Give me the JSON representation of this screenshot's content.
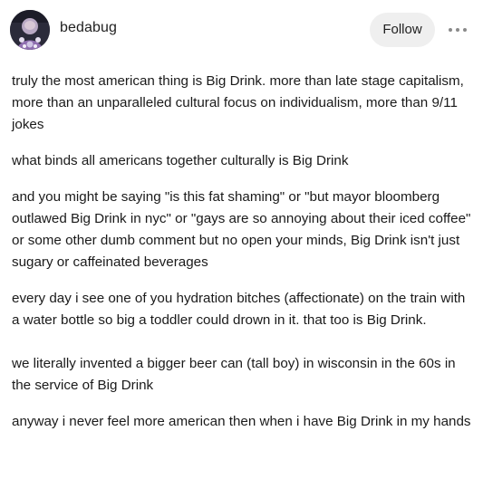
{
  "post": {
    "author": "bedabug",
    "follow_label": "Follow",
    "paragraphs": [
      "truly the most american thing is Big Drink. more than late stage capitalism, more than an unparalleled cultural focus on individualism, more than 9/11 jokes",
      "what binds all americans together culturally is Big Drink",
      "and you might be saying \"is this fat shaming\" or \"but mayor bloomberg outlawed Big Drink in nyc\" or \"gays are so annoying about their iced coffee\" or some other dumb comment but no open your minds, Big Drink isn't just sugary or caffeinated beverages",
      "every day i see one of you hydration bitches (affectionate) on the train with a water bottle so big a toddler could drown in it. that too is Big Drink.",
      "we literally invented a bigger beer can (tall boy) in wisconsin in the 60s in the service of Big Drink",
      "anyway i never feel more american then when i have Big Drink in my hands"
    ]
  },
  "icons": {
    "avatar": "avatar-image",
    "more": "more-options-icon"
  },
  "colors": {
    "background": "#ffffff",
    "text": "#1a1a1a",
    "follow_button_bg": "#efefef",
    "icon_gray": "#8a8a8a"
  }
}
